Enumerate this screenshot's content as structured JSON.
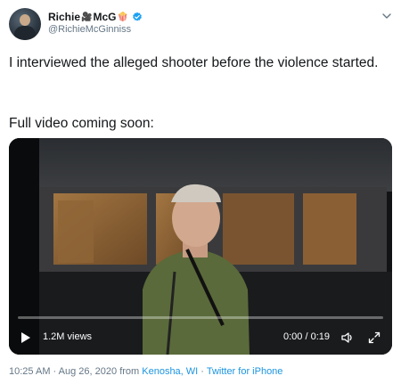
{
  "author": {
    "display_name": "Richie",
    "display_name_suffix": "McG",
    "emoji_1": "🎥",
    "emoji_2": "🍿",
    "handle": "@RichieMcGinniss",
    "verified": true
  },
  "tweet": {
    "text_line_1": "I interviewed the alleged shooter before the violence started.",
    "text_line_2": "Full video coming soon:"
  },
  "video": {
    "views": "1.2M views",
    "time": "0:00 / 0:19",
    "progress": 0
  },
  "meta": {
    "time": "10:25 AM",
    "date": "Aug 26, 2020",
    "from_label": "from",
    "location": "Kenosha, WI",
    "source": "Twitter for iPhone",
    "separator": "·"
  },
  "colors": {
    "link": "#1b95e0",
    "verified": "#1da1f2",
    "muted": "#657786"
  },
  "icons": [
    "verified-badge-icon",
    "chevron-down-icon",
    "play-icon",
    "volume-icon",
    "fullscreen-icon"
  ]
}
